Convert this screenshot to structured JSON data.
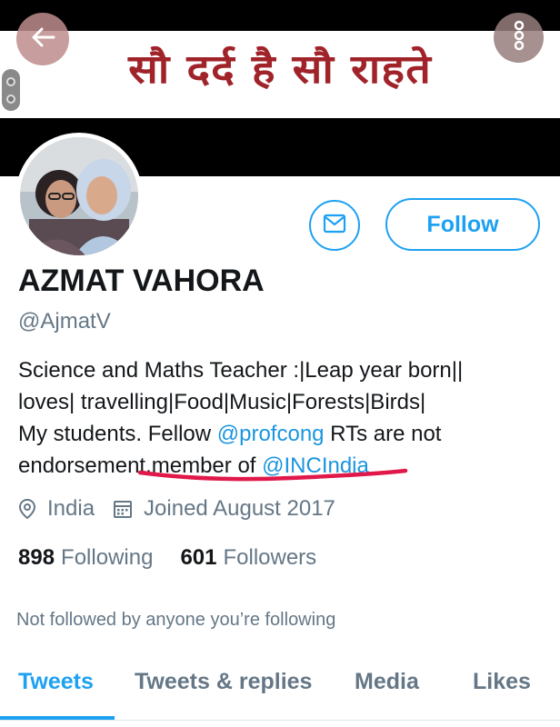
{
  "header": {
    "banner_text": "सौ दर्द है सौ राहते"
  },
  "profile": {
    "display_name": "AZMAT VAHORA",
    "handle": "@AjmatV",
    "follow_label": "Follow",
    "bio": {
      "line1": "Science and Maths Teacher :|Leap year born||",
      "line2": "loves| travelling|Food|Music|Forests|Birds|",
      "line3_prefix": "My students. Fellow ",
      "mention1": "@profcong",
      "line3_suffix": " RTs are not",
      "line4_prefix": "endorsement.member of ",
      "mention2": "@INCIndia"
    },
    "location": "India",
    "joined": "Joined August 2017",
    "following_count": "898",
    "following_label": "Following",
    "followers_count": "601",
    "followers_label": "Followers",
    "not_followed_text": "Not followed by anyone you’re following"
  },
  "tabs": [
    {
      "label": "Tweets",
      "active": true
    },
    {
      "label": "Tweets & replies",
      "active": false
    },
    {
      "label": "Media",
      "active": false
    },
    {
      "label": "Likes",
      "active": false
    }
  ],
  "colors": {
    "accent": "#1da1f2",
    "secondary_text": "#657786",
    "banner_text": "#a0232a",
    "annotation_underline": "#e0194a"
  },
  "icons": [
    "back-arrow-icon",
    "more-vertical-icon",
    "mail-icon",
    "location-pin-icon",
    "calendar-icon"
  ]
}
